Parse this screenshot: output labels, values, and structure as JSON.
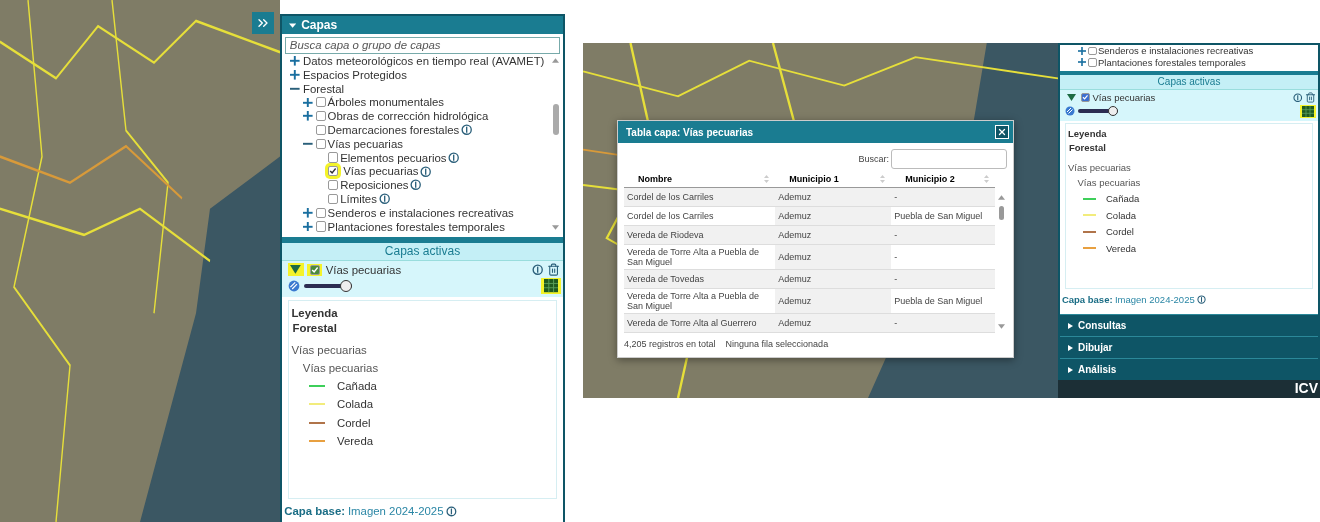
{
  "left_screenshot": {
    "layers_panel": {
      "title": "Capas",
      "expanded": true,
      "search": {
        "placeholder": "Busca capa o grupo de capas"
      },
      "tree": [
        {
          "kind": "group",
          "label": "Datos meteorológicos en tiempo real (AVAMET)",
          "expanded": false,
          "info": false
        },
        {
          "kind": "group",
          "label": "Espacios Protegidos",
          "expanded": false,
          "info": false
        },
        {
          "kind": "group",
          "label": "Forestal",
          "expanded": true,
          "info": false,
          "children": [
            {
              "kind": "layer",
              "label": "Árboles monumentales",
              "expanded": false,
              "checked": false,
              "info": false,
              "highlighted": false
            },
            {
              "kind": "layer",
              "label": "Obras de corrección hidrológica",
              "expanded": false,
              "checked": false,
              "info": false,
              "highlighted": false
            },
            {
              "kind": "layer",
              "label": "Demarcaciones forestales",
              "checked": false,
              "info": true,
              "highlighted": false
            },
            {
              "kind": "layer",
              "label": "Vías pecuarias",
              "expanded": true,
              "checked": false,
              "info": false,
              "highlighted": false,
              "children": [
                {
                  "kind": "layer",
                  "label": "Elementos pecuarios",
                  "checked": false,
                  "info": true,
                  "highlighted": false
                },
                {
                  "kind": "layer",
                  "label": "Vías pecuarias",
                  "checked": true,
                  "info": true,
                  "highlighted": true
                },
                {
                  "kind": "layer",
                  "label": "Reposiciones",
                  "checked": false,
                  "info": true,
                  "highlighted": false
                },
                {
                  "kind": "layer",
                  "label": "Límites",
                  "checked": false,
                  "info": true,
                  "highlighted": false
                }
              ]
            },
            {
              "kind": "layer",
              "label": "Senderos e instalaciones recreativas",
              "expanded": false,
              "checked": false,
              "info": false,
              "highlighted": false
            },
            {
              "kind": "layer",
              "label": "Plantaciones forestales temporales",
              "expanded": false,
              "checked": false,
              "info": false,
              "highlighted": false
            }
          ]
        }
      ]
    },
    "active_layers": {
      "title": "Capas activas",
      "layer": {
        "label": "Vías pecuarias",
        "expanded": true,
        "checked": true,
        "level": 1,
        "toggle_highlighted": true,
        "checkbox_highlighted": true,
        "table_highlighted": true
      },
      "legend": {
        "title": "Leyenda",
        "group": "Forestal",
        "layer": "Vías pecuarias",
        "sublayer": "Vías pecuarias",
        "items": [
          {
            "label": "Cañada",
            "color": "#3ecf5a"
          },
          {
            "label": "Colada",
            "color": "#f2ec7c"
          },
          {
            "label": "Cordel",
            "color": "#b0744a"
          },
          {
            "label": "Vereda",
            "color": "#e8a040"
          }
        ]
      },
      "base": {
        "label": "Capa base:",
        "value": "Imagen 2024-2025"
      }
    }
  },
  "right_screenshot": {
    "tree": [
      {
        "kind": "layer",
        "label": "Senderos e instalaciones recreativas",
        "expanded": false,
        "checked": false,
        "info": false,
        "highlighted": false
      },
      {
        "kind": "layer",
        "label": "Plantaciones forestales temporales",
        "expanded": false,
        "checked": false,
        "info": false,
        "highlighted": false
      }
    ],
    "active_layers": {
      "title": "Capas activas",
      "layer": {
        "label": "Vías pecuarias",
        "expanded": true,
        "checked": true,
        "level": 1,
        "toggle_highlighted": false,
        "checkbox_highlighted": false,
        "table_highlighted": true
      },
      "legend": {
        "title": "Leyenda",
        "group": "Forestal",
        "layer": "Vías pecuarias",
        "sublayer": "Vías pecuarias",
        "items": [
          {
            "label": "Cañada",
            "color": "#3ecf5a"
          },
          {
            "label": "Colada",
            "color": "#f2ec7c"
          },
          {
            "label": "Cordel",
            "color": "#b0744a"
          },
          {
            "label": "Vereda",
            "color": "#e8a040"
          }
        ]
      },
      "base": {
        "label": "Capa base:",
        "value": "Imagen 2024-2025"
      }
    },
    "accordion": [
      {
        "label": "Consultas",
        "expanded": false
      },
      {
        "label": "Dibujar",
        "expanded": false
      },
      {
        "label": "Análisis",
        "expanded": false
      }
    ],
    "dialog": {
      "title": "Tabla capa: Vías pecuarias",
      "search_label": "Buscar:",
      "columns": [
        "Nombre",
        "Municipio 1",
        "Municipio 2"
      ],
      "rows": [
        [
          "Cordel de los Carriles",
          "Ademuz",
          "-"
        ],
        [
          "Cordel de los Carriles",
          "Ademuz",
          "Puebla de San Miguel"
        ],
        [
          "Vereda de Riodeva",
          "Ademuz",
          "-"
        ],
        [
          "Vereda de Torre Alta a Puebla de San Miguel",
          "Ademuz",
          "-"
        ],
        [
          "Vereda de Tovedas",
          "Ademuz",
          "-"
        ],
        [
          "Vereda de Torre Alta a Puebla de San Miguel",
          "Ademuz",
          "Puebla de San Miguel"
        ],
        [
          "Vereda de Torre Alta al Guerrero",
          "Ademuz",
          "-"
        ]
      ],
      "total": "4,205 registros en total",
      "selection": "Ninguna fila seleccionada"
    },
    "logo": "ICV"
  }
}
